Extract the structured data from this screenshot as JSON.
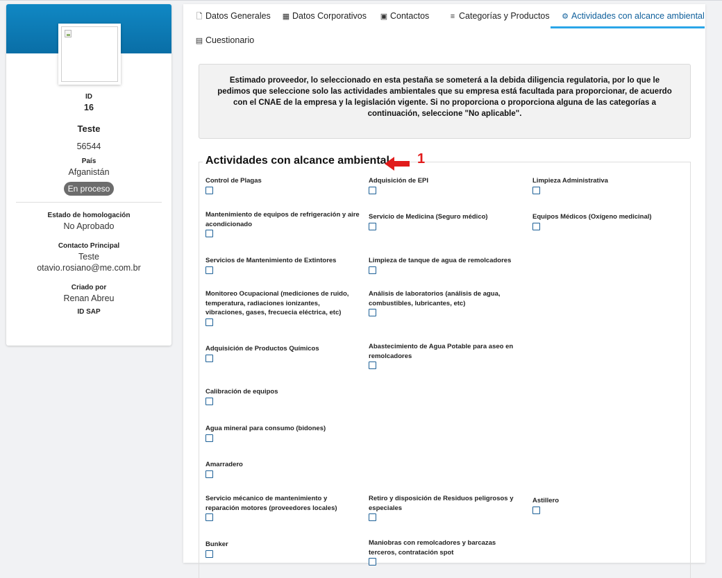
{
  "profile": {
    "id_label": "ID",
    "id_value": "16",
    "name": "Teste",
    "code": "56544",
    "country_label": "País",
    "country": "Afganistán",
    "status": "En proceso",
    "homolog_label": "Estado de homologación",
    "homolog_value": "No Aprobado",
    "contact_label": "Contacto Principal",
    "contact_name": "Teste",
    "contact_email": "otavio.rosiano@me.com.br",
    "created_label": "Criado por",
    "created_by": "Renan Abreu",
    "sap_label": "ID SAP"
  },
  "tabs": [
    {
      "label": "Datos Generales",
      "icon": "document-icon"
    },
    {
      "label": "Datos Corporativos",
      "icon": "building-icon"
    },
    {
      "label": "Contactos",
      "icon": "contact-card-icon"
    },
    {
      "label": "Categorías y Productos",
      "icon": "list-tree-icon"
    },
    {
      "label": "Actividades con alcance ambiental",
      "icon": "gear-icon",
      "active": true
    },
    {
      "label": "Cuestionario",
      "icon": "list-icon"
    }
  ],
  "notice": "Estimado proveedor, lo seleccionado en esta pestaña se someterá a la debida diligencia regulatoria, por lo que le pedimos que seleccione solo las actividades ambientales que su empresa está facultada para proporcionar, de acuerdo con el CNAE de la empresa y la legislación vigente. Si no proporciona o proporciona alguna de las categorías a continuación, seleccione \"No aplicable\".",
  "section": {
    "title": "Actividades con alcance ambiental",
    "annotation_number": "1",
    "annotation_color": "#e11b1b"
  },
  "activities": {
    "col1": [
      "Control de Plagas",
      "Mantenimiento de equipos de refrigeración y aire acondicionado",
      "Servicios de Mantenimiento de Extintores",
      "Monitoreo Ocupacional (mediciones de ruido, temperatura, radiaciones ionizantes, vibraciones, gases, frecuecia eléctrica, etc)",
      "Adquisición de Productos Químicos",
      "Calibración de equipos",
      "Agua mineral para consumo (bidones)",
      "Amarradero",
      "Servicio mécanico de mantenimiento y reparación motores (proveedores locales)",
      "Bunker"
    ],
    "col2": [
      "Adquisición de EPI",
      "Servicio de Medicina (Seguro médico)",
      "Limpieza de tanque de agua de remolcadores",
      "Análisis de laboratorios (análisis de agua, combustibles, lubricantes, etc)",
      "Abastecimiento de Agua Potable para aseo en remolcadores",
      "Retiro y disposición de Residuos peligrosos y especiales",
      "Maniobras con remolcadores y barcazas terceros, contratación spot"
    ],
    "col3": [
      "Limpieza Administrativa",
      "Equipos Médicos (Oxígeno medicinal)",
      "Astillero"
    ]
  },
  "colors": {
    "banner": "#0a6ea6",
    "active_tab": "#0e5f9b",
    "tab_underline": "#2aa6e8",
    "checkbox_border": "#1b5f96"
  }
}
